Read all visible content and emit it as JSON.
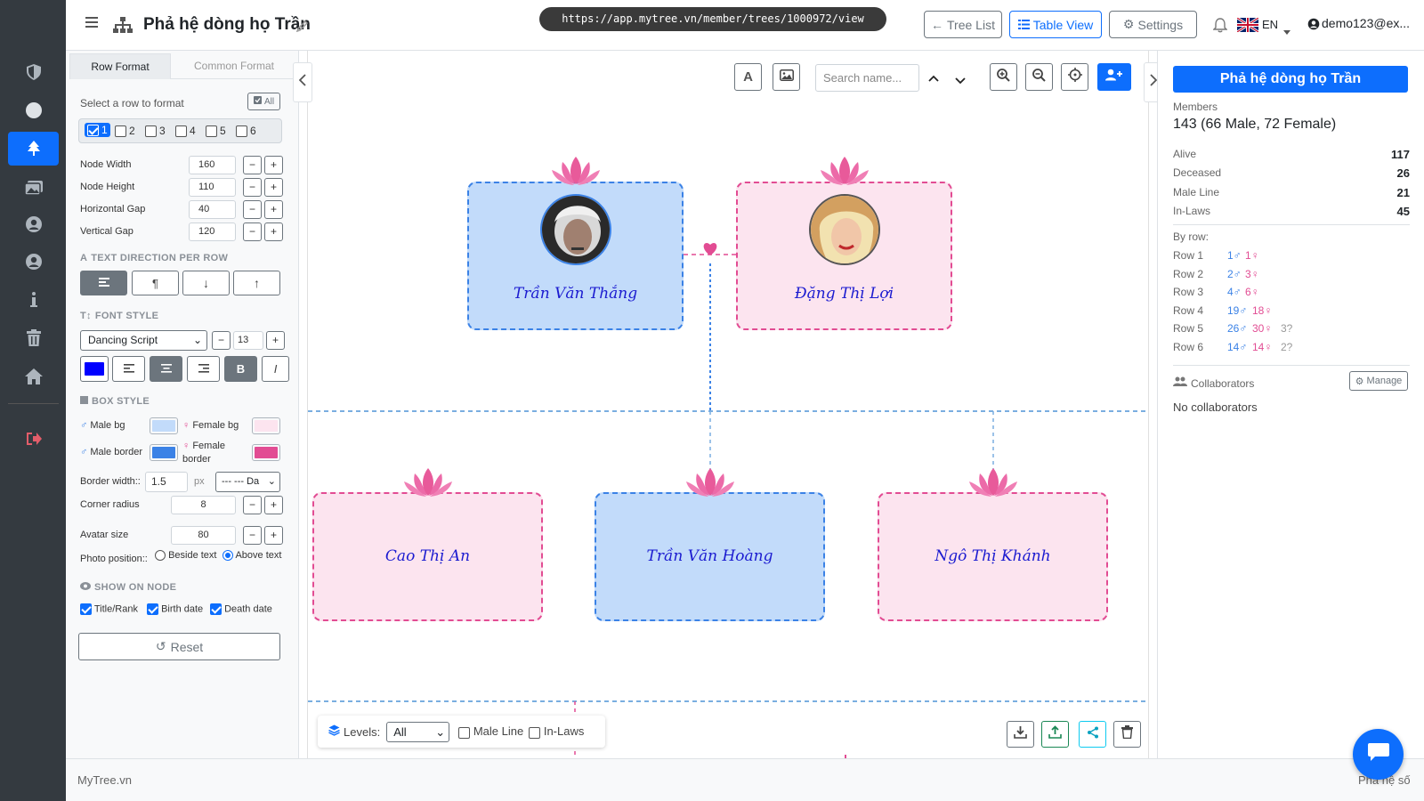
{
  "colors": {
    "primary": "#0d6efd",
    "male_bg": "#c2dbfa",
    "male_border": "#3b82e6",
    "female_bg": "#fce4ef",
    "female_border": "#e24c93",
    "text_color": "#0000ff"
  },
  "topbar": {
    "title": "Phả hệ dòng họ Trần",
    "url": "https://app.mytree.vn/member/trees/1000972/view",
    "tree_list": "Tree List",
    "table_view": "Table View",
    "settings": "Settings",
    "lang": "EN",
    "user": "demo123@ex..."
  },
  "left": {
    "tabs": [
      "Row Format",
      "Common Format"
    ],
    "select_row": "Select a row to format",
    "all": "All",
    "rows": [
      "1",
      "2",
      "3",
      "4",
      "5",
      "6"
    ],
    "node_width_label": "Node Width",
    "node_width": "160",
    "node_height_label": "Node Height",
    "node_height": "110",
    "hgap_label": "Horizontal Gap",
    "hgap": "40",
    "vgap_label": "Vertical Gap",
    "vgap": "120",
    "text_dir": "TEXT DIRECTION PER ROW",
    "font_style": "FONT STYLE",
    "font": "Dancing Script",
    "font_size": "13",
    "bold": "B",
    "italic": "I",
    "box_style": "BOX STYLE",
    "male_bg": "Male bg",
    "female_bg": "Female bg",
    "male_border": "Male border",
    "female_border_1": "Female",
    "female_border_2": "border",
    "border_width_label": "Border width::",
    "border_width": "1.5",
    "px": "px",
    "border_style": "--- --- Da",
    "corner_label": "Corner radius",
    "corner": "8",
    "avatar_label": "Avatar size",
    "avatar": "80",
    "photo_pos": "Photo position::",
    "beside": "Beside text",
    "above": "Above text",
    "show_on_node": "SHOW ON NODE",
    "opt_title": "Title/Rank",
    "opt_birth": "Birth date",
    "opt_death": "Death date",
    "reset": "Reset",
    "minus": "−",
    "plus": "+"
  },
  "canvas": {
    "search_placeholder": "Search name...",
    "nodes": [
      {
        "name": "Trần Văn Thắng",
        "gender": "male"
      },
      {
        "name": "Đặng Thị Lợi",
        "gender": "female"
      },
      {
        "name": "Cao Thị An",
        "gender": "female"
      },
      {
        "name": "Trần Văn Hoàng",
        "gender": "male"
      },
      {
        "name": "Ngô Thị Khánh",
        "gender": "female"
      }
    ],
    "levels_label": "Levels:",
    "levels_value": "All",
    "male_line": "Male Line",
    "in_laws": "In-Laws"
  },
  "right": {
    "title": "Phả hệ dòng họ Trần",
    "members_label": "Members",
    "members": "143 (66 Male, 72 Female)",
    "stats": [
      {
        "label": "Alive",
        "value": "117"
      },
      {
        "label": "Deceased",
        "value": "26"
      },
      {
        "label": "Male Line",
        "value": "21"
      },
      {
        "label": "In-Laws",
        "value": "45"
      }
    ],
    "by_row": "By row:",
    "rows": [
      {
        "label": "Row 1",
        "m": "1♂",
        "f": "1♀",
        "u": ""
      },
      {
        "label": "Row 2",
        "m": "2♂",
        "f": "3♀",
        "u": ""
      },
      {
        "label": "Row 3",
        "m": "4♂",
        "f": "6♀",
        "u": ""
      },
      {
        "label": "Row 4",
        "m": "19♂",
        "f": "18♀",
        "u": ""
      },
      {
        "label": "Row 5",
        "m": "26♂",
        "f": "30♀",
        "u": "3?"
      },
      {
        "label": "Row 6",
        "m": "14♂",
        "f": "14♀",
        "u": "2?"
      }
    ],
    "collaborators": "Collaborators",
    "manage": "Manage",
    "no_collab": "No collaborators"
  },
  "footer": {
    "brand": "MyTree.vn",
    "right": "Phả hệ số"
  }
}
